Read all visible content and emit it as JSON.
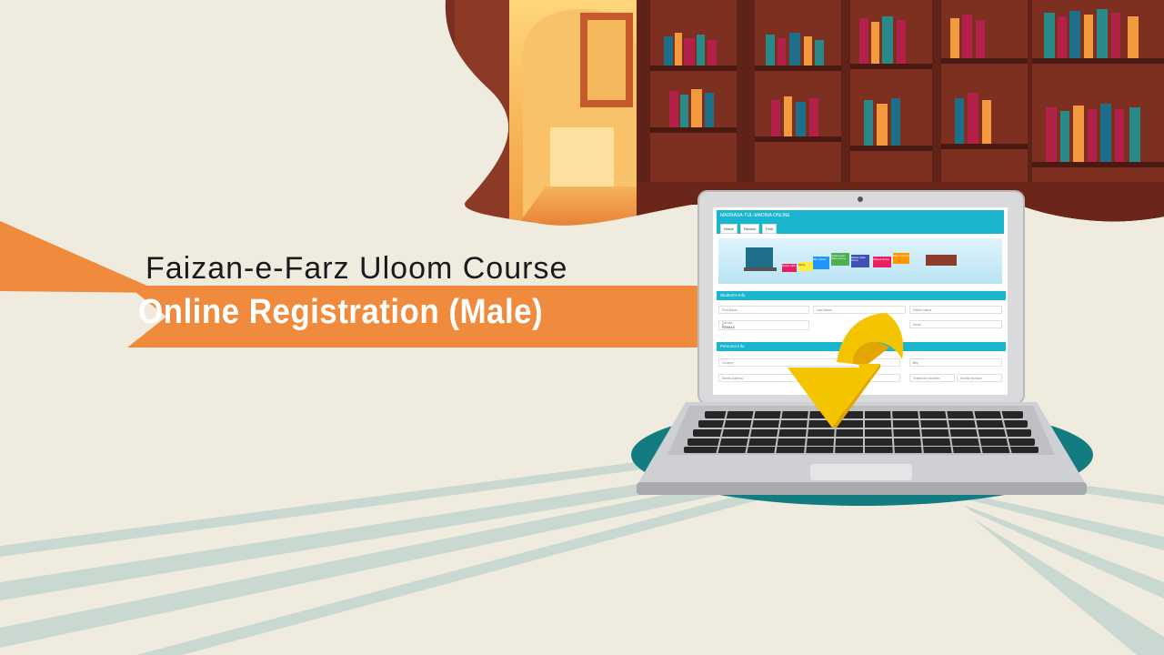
{
  "hero": {
    "title": "Faizan-e-Farz Uloom Course",
    "subtitle": "Online Registration (Male)"
  },
  "screen": {
    "brand": "MADRASA-TUL-MADINA ONLINE",
    "nav_buttons": [
      "Home",
      "Review",
      "Print"
    ],
    "banner_tiles": [
      "Madani Qaida",
      "Nazira",
      "Hifz-e-Quran",
      "Faizan-e-Farz Uloom Course",
      "Madani Qaida Course",
      "Tajweed Course",
      "Tarjama Course"
    ],
    "section_student": "Student's Info",
    "student_fields": {
      "first_name": "First Name",
      "last_name": "Last Name",
      "father_name": "Father Name",
      "gender_label": "Gender",
      "gender_value": "FEMALE",
      "email": "Email"
    },
    "section_personal": "Personal Info",
    "personal_fields": {
      "country": "Country",
      "city": "City",
      "street": "Street Address",
      "phone_home": "Telephone Number",
      "phone_mobile": "Mobile Number"
    }
  },
  "colors": {
    "background": "#f0ebdf",
    "ribbon": "#f08a3c",
    "accent": "#1bb5cf",
    "arrow": "#f5c400",
    "platform": "#137c80"
  }
}
